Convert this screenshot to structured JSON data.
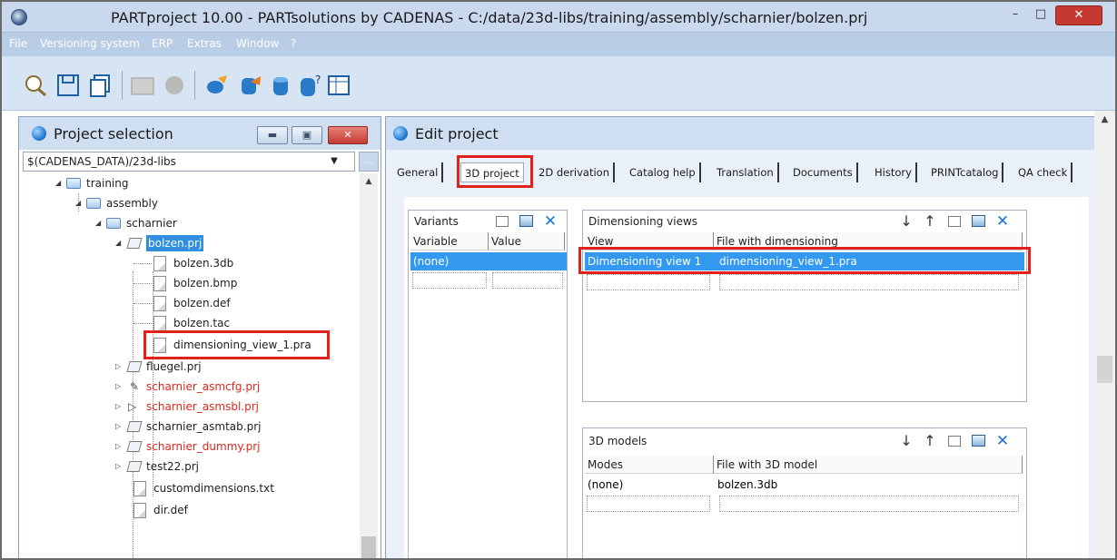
{
  "window": {
    "title": "PARTproject 10.00 - PARTsolutions by CADENAS - C:/data/23d-libs/training/assembly/scharnier/bolzen.prj",
    "min_glyph": "–",
    "max_glyph": "□",
    "close_glyph": "✕"
  },
  "menu": [
    "File",
    "Versioning system",
    "ERP",
    "Extras",
    "Window",
    "?"
  ],
  "toolbar": {
    "icons": [
      "search-part-icon",
      "save-icon",
      "copy-icon",
      "3d-view-icon",
      "sphere-icon",
      "edit-icon",
      "database-edit-icon",
      "database-icon",
      "database-help-icon",
      "table-icon"
    ]
  },
  "project_selection": {
    "title": "Project selection",
    "path": "$(CADENAS_DATA)/23d-libs",
    "combo_arrow": "▼",
    "browse_label": "...",
    "tree": [
      {
        "label": "training"
      },
      {
        "label": "assembly"
      },
      {
        "label": "scharnier"
      },
      {
        "label": "bolzen.prj",
        "selected": true
      },
      {
        "label": "bolzen.3db"
      },
      {
        "label": "bolzen.bmp"
      },
      {
        "label": "bolzen.def"
      },
      {
        "label": "bolzen.tac"
      },
      {
        "label": "dimensioning_view_1.pra"
      },
      {
        "label": "fluegel.prj"
      },
      {
        "label": "scharnier_asmcfg.prj",
        "red": true
      },
      {
        "label": "scharnier_asmsbl.prj",
        "red": true
      },
      {
        "label": "scharnier_asmtab.prj"
      },
      {
        "label": "scharnier_dummy.prj",
        "red": true
      },
      {
        "label": "test22.prj"
      },
      {
        "label": "customdimensions.txt"
      },
      {
        "label": "dir.def"
      }
    ]
  },
  "edit_project": {
    "title": "Edit project",
    "tabs": [
      "General",
      "3D project",
      "2D derivation",
      "Catalog help",
      "Translation",
      "Documents",
      "History",
      "PRINTcatalog",
      "QA check"
    ],
    "active_tab": "3D project",
    "variants": {
      "title": "Variants",
      "columns": [
        "Variable",
        "Value"
      ],
      "rows": [
        [
          "(none)",
          ""
        ]
      ]
    },
    "dimensioning_views": {
      "title": "Dimensioning views",
      "columns": [
        "View",
        "File with dimensioning"
      ],
      "rows": [
        [
          "Dimensioning view 1",
          "dimensioning_view_1.pra"
        ]
      ]
    },
    "models_3d": {
      "title": "3D models",
      "columns": [
        "Modes",
        "File with 3D model"
      ],
      "rows": [
        [
          "(none)",
          "bolzen.3db"
        ]
      ]
    },
    "glyphs": {
      "down": "↓",
      "up": "↑",
      "delete": "✕"
    }
  },
  "colors": {
    "highlight_red": "#e0221b",
    "selection_blue": "#3399f0",
    "accent_blue": "#1a73d8"
  }
}
